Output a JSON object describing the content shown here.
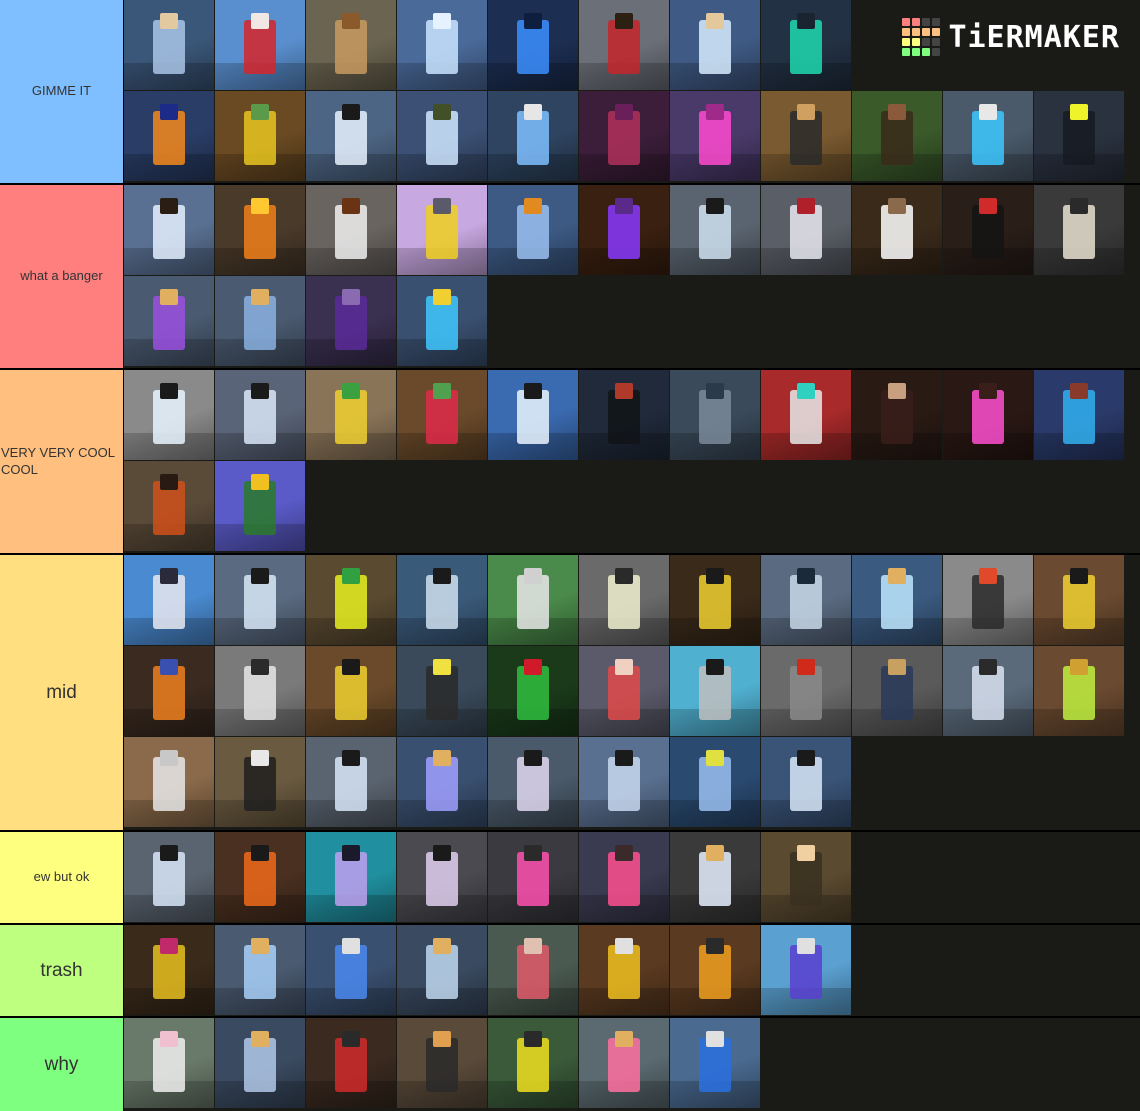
{
  "brand": {
    "name": "TiERMAKER",
    "grid_colors": [
      "#ff7f7f",
      "#ff7f7f",
      "#444444",
      "#444444",
      "#ffbf7f",
      "#ffbf7f",
      "#ffbf7f",
      "#ffbf7f",
      "#ffff7f",
      "#ffff7f",
      "#444444",
      "#444444",
      "#7fff7f",
      "#7fff7f",
      "#7fff7f",
      "#444444"
    ]
  },
  "tiers": [
    {
      "label": "GIMME IT",
      "color": "#7fbfff",
      "font_size": "small",
      "items": [
        {
          "bg": "#3a5678",
          "fig": "#a9c4e6",
          "head": "#e3c9a0"
        },
        {
          "bg": "#5a8fcf",
          "fig": "#d6262a",
          "head": "#f1e8e6"
        },
        {
          "bg": "#6a6450",
          "fig": "#c89a60",
          "head": "#8a5a2a"
        },
        {
          "bg": "#4a6a9a",
          "fig": "#c9e4ff",
          "head": "#e6f2ff"
        },
        {
          "bg": "#1c2e52",
          "fig": "#3b8fff",
          "head": "#0d1e3e"
        },
        {
          "bg": "#6b6f78",
          "fig": "#c4262a",
          "head": "#2b2012"
        },
        {
          "bg": "#3f5a84",
          "fig": "#d7ecff",
          "head": "#e2c89a"
        },
        {
          "bg": "#233144",
          "fig": "#1fd9b0",
          "head": "#1a2430"
        },
        {
          "bg": "#2a3d66",
          "fig": "#f58a1c",
          "head": "#1c2a88"
        },
        {
          "bg": "#6a4a22",
          "fig": "#e8c520",
          "head": "#5a9a4a"
        },
        {
          "bg": "#4d6584",
          "fig": "#e8f2ff",
          "head": "#1a1a1a"
        },
        {
          "bg": "#3b5074",
          "fig": "#cfe6ff",
          "head": "#42502a"
        },
        {
          "bg": "#2e4460",
          "fig": "#7fbfff",
          "head": "#e6e6e6"
        },
        {
          "bg": "#3c1e3a",
          "fig": "#b0305a",
          "head": "#6a1e5a"
        },
        {
          "bg": "#4a3a6a",
          "fig": "#ff4ad0",
          "head": "#a02a8a"
        },
        {
          "bg": "#7a5a30",
          "fig": "#2a2a2a",
          "head": "#d0a060"
        },
        {
          "bg": "#3a5a2a",
          "fig": "#3a2a1a",
          "head": "#8a5a3a"
        },
        {
          "bg": "#4a5a6a",
          "fig": "#3cc8ff",
          "head": "#e8e8e8"
        },
        {
          "bg": "#2a3240",
          "fig": "#151a22",
          "head": "#eff32a"
        }
      ]
    },
    {
      "label": "what a banger",
      "color": "#ff7f7f",
      "font_size": "small",
      "items": [
        {
          "bg": "#5a7092",
          "fig": "#e4f0ff",
          "head": "#2a1e14"
        },
        {
          "bg": "#4a3a2a",
          "fig": "#f0801a",
          "head": "#ffc830"
        },
        {
          "bg": "#6a6460",
          "fig": "#f0f0f0",
          "head": "#6a3414"
        },
        {
          "bg": "#c8a8e0",
          "fig": "#f0d020",
          "head": "#5a5a6a"
        },
        {
          "bg": "#3c5a84",
          "fig": "#9ac0f0",
          "head": "#e08a20"
        },
        {
          "bg": "#3a2010",
          "fig": "#8a3aff",
          "head": "#5a2a8a"
        },
        {
          "bg": "#5a6470",
          "fig": "#cfe0f0",
          "head": "#1a1a1a"
        },
        {
          "bg": "#5a5e66",
          "fig": "#e8e8f0",
          "head": "#b0202a"
        },
        {
          "bg": "#3a2a1a",
          "fig": "#ffffff",
          "head": "#8a6a4a"
        },
        {
          "bg": "#2a1e18",
          "fig": "#141414",
          "head": "#d02a2a"
        },
        {
          "bg": "#3a3a3a",
          "fig": "#e8e2d0",
          "head": "#2a2a2a"
        },
        {
          "bg": "#4a5a70",
          "fig": "#9a50e0",
          "head": "#e0b060"
        },
        {
          "bg": "#4a5a70",
          "fig": "#8ab0e0",
          "head": "#e0b060"
        },
        {
          "bg": "#3a3050",
          "fig": "#5a2a9a",
          "head": "#8a6ab0"
        },
        {
          "bg": "#3a5070",
          "fig": "#40c8ff",
          "head": "#f0d030"
        }
      ]
    },
    {
      "label": "VERY VERY COOL COOL",
      "color": "#ffbf7f",
      "font_size": "small",
      "align": "left",
      "items": [
        {
          "bg": "#8a8a8a",
          "fig": "#e8f4ff",
          "head": "#1a1a1a"
        },
        {
          "bg": "#5a6478",
          "fig": "#d8e6f8",
          "head": "#1a1a1a"
        },
        {
          "bg": "#8a7458",
          "fig": "#f0d030",
          "head": "#3aa040"
        },
        {
          "bg": "#6a4a2a",
          "fig": "#e02a4a",
          "head": "#50a050"
        },
        {
          "bg": "#3a6ab0",
          "fig": "#eaf4ff",
          "head": "#1a1a1a"
        },
        {
          "bg": "#202a3a",
          "fig": "#101418",
          "head": "#b03a2a"
        },
        {
          "bg": "#3a4a5a",
          "fig": "#7a8a9a",
          "head": "#2a3a4a"
        },
        {
          "bg": "#a82a2a",
          "fig": "#e8e8e8",
          "head": "#30d0c0"
        },
        {
          "bg": "#2a1a14",
          "fig": "#3a1e1a",
          "head": "#c8a080"
        },
        {
          "bg": "#2a1814",
          "fig": "#ff50d0",
          "head": "#3a1e1a"
        },
        {
          "bg": "#2a3a6a",
          "fig": "#30b0f0",
          "head": "#8a3a2a"
        },
        {
          "bg": "#5a4a38",
          "fig": "#d0501a",
          "head": "#2a1a14"
        },
        {
          "bg": "#5a5ac8",
          "fig": "#2a7a2a",
          "head": "#f0c020"
        }
      ]
    },
    {
      "label": "mid",
      "color": "#ffdf7f",
      "font_size": "large",
      "items": [
        {
          "bg": "#4a8ad0",
          "fig": "#e8e8f0",
          "head": "#2a2a3a"
        },
        {
          "bg": "#5a6a80",
          "fig": "#d8e8f8",
          "head": "#1a1a1a"
        },
        {
          "bg": "#5a4a30",
          "fig": "#e8f020",
          "head": "#30a040"
        },
        {
          "bg": "#3a5a7a",
          "fig": "#cfe0f0",
          "head": "#1a1a1a"
        },
        {
          "bg": "#4a8a4a",
          "fig": "#e8e8e8",
          "head": "#d0d0d0"
        },
        {
          "bg": "#6a6a6a",
          "fig": "#f0f0d0",
          "head": "#2a2a2a"
        },
        {
          "bg": "#3a2a1a",
          "fig": "#f0d030",
          "head": "#1a1a1a"
        },
        {
          "bg": "#5a6a80",
          "fig": "#c8d8e8",
          "head": "#1a2a3a"
        },
        {
          "bg": "#3a5a80",
          "fig": "#c0e8ff",
          "head": "#e0b060"
        },
        {
          "bg": "#8a8a8a",
          "fig": "#2a2a2a",
          "head": "#e04a2a"
        },
        {
          "bg": "#6a4a30",
          "fig": "#f0d030",
          "head": "#1a1a1a"
        },
        {
          "bg": "#3a2a20",
          "fig": "#f08020",
          "head": "#3a50b0"
        },
        {
          "bg": "#7a7a7a",
          "fig": "#e8e8e8",
          "head": "#2a2a2a"
        },
        {
          "bg": "#6a4a2a",
          "fig": "#f0d030",
          "head": "#1a1a1a"
        },
        {
          "bg": "#3a4a5a",
          "fig": "#2a2a2a",
          "head": "#f0e040"
        },
        {
          "bg": "#1a3a1a",
          "fig": "#30c040",
          "head": "#d01a2a"
        },
        {
          "bg": "#5a5a6a",
          "fig": "#e04a4a",
          "head": "#f0d0c0"
        },
        {
          "bg": "#50b0d0",
          "fig": "#c0c0c0",
          "head": "#1a1a1a"
        },
        {
          "bg": "#6a6a6a",
          "fig": "#8a8a8a",
          "head": "#d02a1a"
        },
        {
          "bg": "#5a5a5a",
          "fig": "#2a3a5a",
          "head": "#c8a060"
        },
        {
          "bg": "#5a6a7a",
          "fig": "#d8e0f0",
          "head": "#2a2a2a"
        },
        {
          "bg": "#6a4a30",
          "fig": "#c0f040",
          "head": "#d0a030"
        },
        {
          "bg": "#8a6a4a",
          "fig": "#e8e8e8",
          "head": "#c8c8c8"
        },
        {
          "bg": "#6a5a40",
          "fig": "#202020",
          "head": "#e8e8e8"
        },
        {
          "bg": "#5a6470",
          "fig": "#d8e6f8",
          "head": "#1a1a1a"
        },
        {
          "bg": "#3a5070",
          "fig": "#a0a0ff",
          "head": "#e0b060"
        },
        {
          "bg": "#4a5a6a",
          "fig": "#e0d8f0",
          "head": "#1a1a1a"
        },
        {
          "bg": "#5a7090",
          "fig": "#c8d8f0",
          "head": "#1a1a1a"
        },
        {
          "bg": "#2a4a70",
          "fig": "#9ac0f0",
          "head": "#e0e040"
        },
        {
          "bg": "#3a5478",
          "fig": "#d8e8f8",
          "head": "#1a1a1a"
        }
      ]
    },
    {
      "label": "ew but ok",
      "color": "#ffff7f",
      "font_size": "small",
      "items": [
        {
          "bg": "#5a6470",
          "fig": "#d8e6f8",
          "head": "#1a1a1a"
        },
        {
          "bg": "#4a3020",
          "fig": "#f06a1a",
          "head": "#1a1a1a"
        },
        {
          "bg": "#2090a0",
          "fig": "#c0a0f0",
          "head": "#1a1a2a"
        },
        {
          "bg": "#4a4a50",
          "fig": "#e0d0f0",
          "head": "#1a1a1a"
        },
        {
          "bg": "#3a3a40",
          "fig": "#ff50b0",
          "head": "#2a2a2a"
        },
        {
          "bg": "#3a3a50",
          "fig": "#ff5090",
          "head": "#3a2a2a"
        },
        {
          "bg": "#3a3a3a",
          "fig": "#e8f0ff",
          "head": "#e0b060"
        },
        {
          "bg": "#5a4a30",
          "fig": "#3a3020",
          "head": "#f0d0a0"
        }
      ]
    },
    {
      "label": "trash",
      "color": "#bfff7f",
      "font_size": "large",
      "items": [
        {
          "bg": "#3a2a1a",
          "fig": "#e8c020",
          "head": "#c02a6a"
        },
        {
          "bg": "#4a5a70",
          "fig": "#a8d0f8",
          "head": "#e0b060"
        },
        {
          "bg": "#3a5070",
          "fig": "#4a8af0",
          "head": "#e0e0e0"
        },
        {
          "bg": "#3a4a60",
          "fig": "#c0d8f0",
          "head": "#e0b060"
        },
        {
          "bg": "#4a5a50",
          "fig": "#e05a6a",
          "head": "#e0c0b0"
        },
        {
          "bg": "#5a3a20",
          "fig": "#f0c020",
          "head": "#e0e0e0"
        },
        {
          "bg": "#5a3a20",
          "fig": "#f0a020",
          "head": "#2a2a2a"
        },
        {
          "bg": "#5aa0d0",
          "fig": "#5a40d0",
          "head": "#e0e0e0"
        }
      ]
    },
    {
      "label": "why",
      "color": "#7fff7f",
      "font_size": "large",
      "items": [
        {
          "bg": "#6a7a6a",
          "fig": "#f0f0f0",
          "head": "#f0c0d0"
        },
        {
          "bg": "#3a4a60",
          "fig": "#b0c8e8",
          "head": "#e0b060"
        },
        {
          "bg": "#3a2a20",
          "fig": "#d02a2a",
          "head": "#2a2a2a"
        },
        {
          "bg": "#5a4a3a",
          "fig": "#2a2a2a",
          "head": "#e0a050"
        },
        {
          "bg": "#3a5a3a",
          "fig": "#f0e020",
          "head": "#2a2a2a"
        },
        {
          "bg": "#5a6a70",
          "fig": "#ff70a0",
          "head": "#e0b060"
        },
        {
          "bg": "#4a6a90",
          "fig": "#2a70e0",
          "head": "#e0e0e0"
        }
      ]
    }
  ]
}
